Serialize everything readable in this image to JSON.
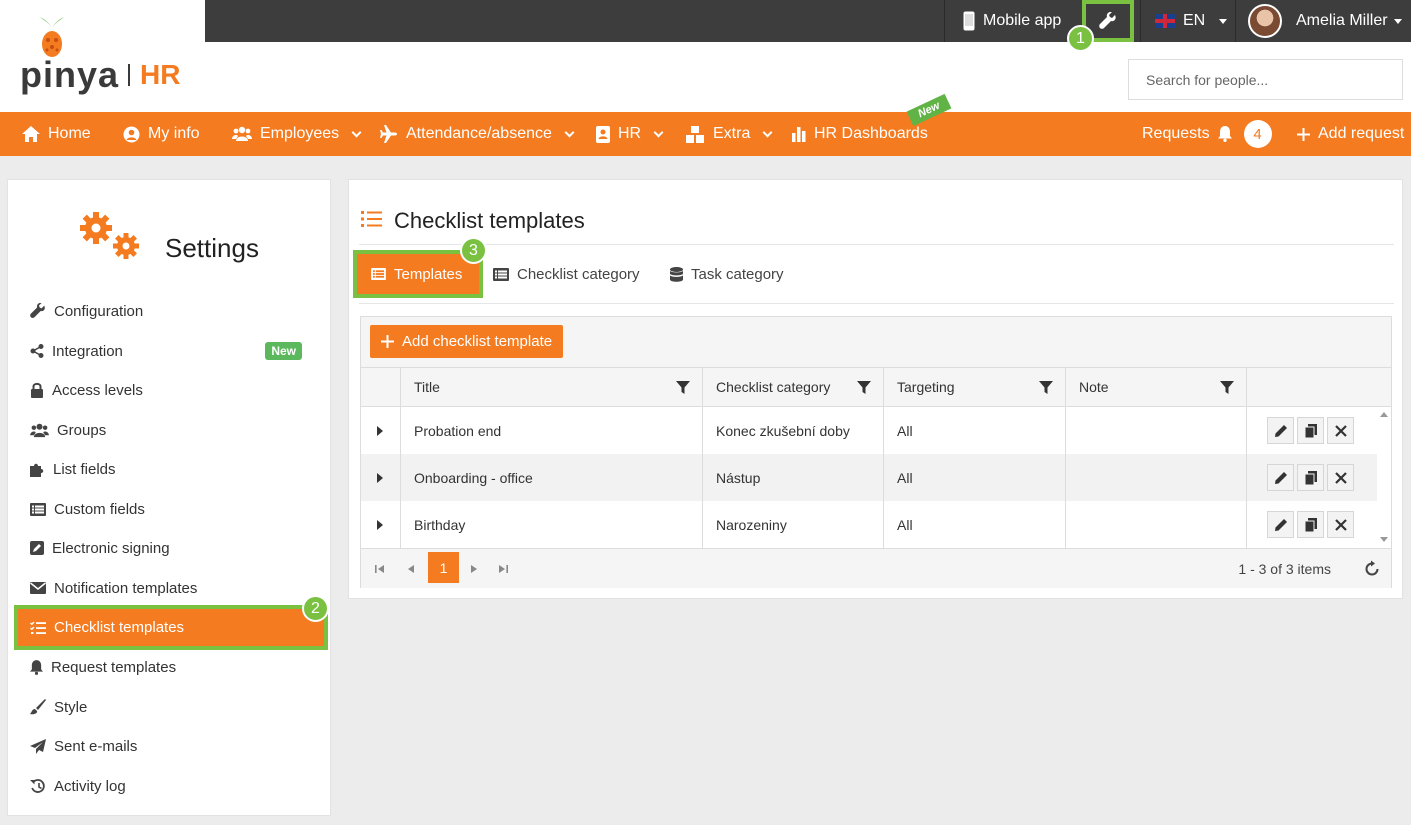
{
  "logo": {
    "word": "pinya",
    "product": "HR"
  },
  "topbar": {
    "mobile_app": "Mobile app",
    "language": "EN",
    "user_name": "Amelia Miller"
  },
  "search": {
    "placeholder": "Search for people..."
  },
  "nav": {
    "home": "Home",
    "my_info": "My info",
    "employees": "Employees",
    "attendance": "Attendance/absence",
    "hr": "HR",
    "extra": "Extra",
    "hr_dashboards": "HR Dashboards",
    "new_ribbon": "New",
    "requests": "Requests",
    "requests_count": "4",
    "add_request": "Add request"
  },
  "sidebar": {
    "title": "Settings",
    "new_badge": "New",
    "items": [
      {
        "label": "Configuration",
        "icon": "wrench-icon"
      },
      {
        "label": "Integration",
        "icon": "share-icon"
      },
      {
        "label": "Access levels",
        "icon": "lock-icon"
      },
      {
        "label": "Groups",
        "icon": "users-icon"
      },
      {
        "label": "List fields",
        "icon": "puzzle-icon"
      },
      {
        "label": "Custom fields",
        "icon": "list-icon"
      },
      {
        "label": "Electronic signing",
        "icon": "sign-icon"
      },
      {
        "label": "Notification templates",
        "icon": "envelope-icon"
      },
      {
        "label": "Checklist templates",
        "icon": "checklist-icon"
      },
      {
        "label": "Request templates",
        "icon": "bell-icon"
      },
      {
        "label": "Style",
        "icon": "brush-icon"
      },
      {
        "label": "Sent e-mails",
        "icon": "paper-plane-icon"
      },
      {
        "label": "Activity log",
        "icon": "history-icon"
      }
    ]
  },
  "main": {
    "title": "Checklist templates",
    "tabs": [
      {
        "label": "Templates"
      },
      {
        "label": "Checklist category"
      },
      {
        "label": "Task category"
      }
    ],
    "add_button": "Add checklist template",
    "columns": [
      "Title",
      "Checklist category",
      "Targeting",
      "Note"
    ],
    "rows": [
      {
        "title": "Probation end",
        "category": "Konec zkušební doby",
        "targeting": "All",
        "note": ""
      },
      {
        "title": "Onboarding - office",
        "category": "Nástup",
        "targeting": "All",
        "note": ""
      },
      {
        "title": "Birthday",
        "category": "Narozeniny",
        "targeting": "All",
        "note": ""
      }
    ],
    "pager": {
      "current_page": "1",
      "info": "1 - 3 of 3 items"
    }
  },
  "steps": [
    "1",
    "2",
    "3"
  ],
  "colors": {
    "accent": "#f47b20",
    "highlight": "#7ac142",
    "topbar": "#3d3d3d"
  }
}
